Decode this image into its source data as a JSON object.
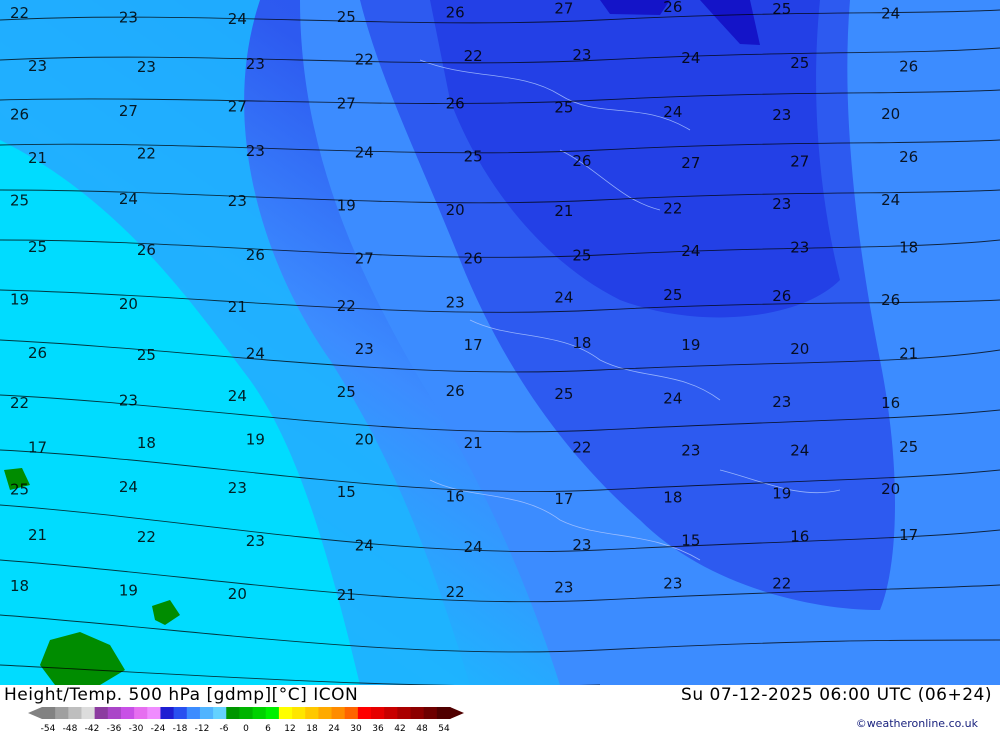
{
  "footer": {
    "title": "Height/Temp. 500 hPa [gdmp][°C] ICON",
    "valid_time": "Su 07-12-2025 06:00 UTC (06+24)",
    "copyright": "©weatheronline.co.uk"
  },
  "legend": {
    "ticks": [
      "-54",
      "-48",
      "-42",
      "-36",
      "-30",
      "-24",
      "-18",
      "-12",
      "-6",
      "0",
      "6",
      "12",
      "18",
      "24",
      "30",
      "36",
      "42",
      "48",
      "54"
    ],
    "colors": [
      "#828282",
      "#a0a0a0",
      "#bebebe",
      "#dcdcdc",
      "#8c3ca0",
      "#aa46c8",
      "#c850e6",
      "#e66ef0",
      "#f08cff",
      "#1e1ed2",
      "#2850f0",
      "#3c8cff",
      "#50b4ff",
      "#64d2ff",
      "#009600",
      "#00b400",
      "#00d200",
      "#00f000",
      "#ffff00",
      "#ffe600",
      "#ffc800",
      "#ffaa00",
      "#ff8c00",
      "#ff6400",
      "#ff0000",
      "#e60000",
      "#c80000",
      "#aa0000",
      "#8c0000",
      "#6e0000",
      "#500000"
    ]
  },
  "map": {
    "background_colors": {
      "cyan": "#00e0ff",
      "light_blue": "#1eb4ff",
      "mid_blue": "#3c8cff",
      "blue": "#2d5af0",
      "dark_blue": "#1e32dc",
      "navy": "#1414c8",
      "green": "#008c00"
    },
    "contour_labels": [
      "22",
      "23",
      "24",
      "25",
      "26",
      "27",
      "26",
      "25",
      "24",
      "23",
      "23",
      "23",
      "22",
      "22",
      "23",
      "24",
      "25",
      "26",
      "26",
      "27",
      "27",
      "27",
      "26",
      "25",
      "24",
      "23",
      "20",
      "21",
      "22",
      "23",
      "24",
      "25",
      "26",
      "27",
      "27",
      "26",
      "25",
      "24",
      "23",
      "19",
      "20",
      "21",
      "22",
      "23",
      "24",
      "25",
      "26",
      "26",
      "27",
      "26",
      "25",
      "24",
      "23",
      "18",
      "19",
      "20",
      "21",
      "22",
      "23",
      "24",
      "25",
      "26",
      "26",
      "26",
      "25",
      "24",
      "23",
      "17",
      "18",
      "19",
      "20",
      "21",
      "22",
      "23",
      "24",
      "25",
      "26",
      "25",
      "24",
      "23",
      "16",
      "17",
      "18",
      "19",
      "20",
      "21",
      "22",
      "23",
      "24",
      "25",
      "25",
      "24",
      "23",
      "15",
      "16",
      "17",
      "18",
      "19",
      "20",
      "21",
      "22",
      "23",
      "24",
      "24",
      "23",
      "15",
      "16",
      "17",
      "18",
      "19",
      "20",
      "21",
      "22",
      "23",
      "23",
      "22"
    ]
  }
}
